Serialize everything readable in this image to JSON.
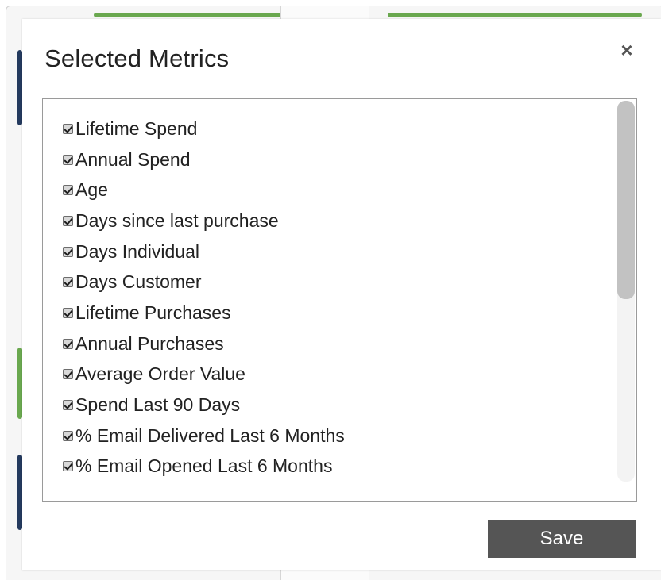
{
  "modal": {
    "title": "Selected Metrics",
    "close_label": "×",
    "save_label": "Save"
  },
  "metrics": [
    {
      "label": "Lifetime Spend",
      "checked": true
    },
    {
      "label": "Annual Spend",
      "checked": true
    },
    {
      "label": "Age",
      "checked": true
    },
    {
      "label": "Days since last purchase",
      "checked": true
    },
    {
      "label": "Days Individual",
      "checked": true
    },
    {
      "label": "Days Customer",
      "checked": true
    },
    {
      "label": "Lifetime Purchases",
      "checked": true
    },
    {
      "label": "Annual Purchases",
      "checked": true
    },
    {
      "label": "Average Order Value",
      "checked": true
    },
    {
      "label": "Spend Last 90 Days",
      "checked": true
    },
    {
      "label": "% Email Delivered Last 6 Months",
      "checked": true
    },
    {
      "label": "% Email Opened Last 6 Months",
      "checked": true
    }
  ],
  "colors": {
    "save_button": "#555555",
    "background_accent_green": "#6aa84f",
    "background_accent_navy": "#243a5e"
  }
}
